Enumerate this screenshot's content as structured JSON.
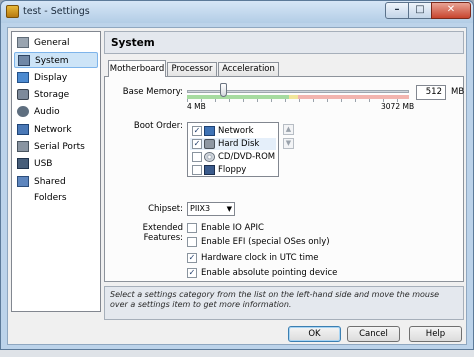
{
  "window": {
    "title": "test - Settings"
  },
  "titlebar": {
    "minimize": "–",
    "maximize": "□",
    "close": "✕"
  },
  "sidebar": {
    "items": [
      {
        "label": "General",
        "icon": "general-icon"
      },
      {
        "label": "System",
        "icon": "system-icon",
        "selected": true
      },
      {
        "label": "Display",
        "icon": "display-icon"
      },
      {
        "label": "Storage",
        "icon": "storage-icon"
      },
      {
        "label": "Audio",
        "icon": "audio-icon"
      },
      {
        "label": "Network",
        "icon": "network-icon"
      },
      {
        "label": "Serial Ports",
        "icon": "serial-ports-icon"
      },
      {
        "label": "USB",
        "icon": "usb-icon"
      },
      {
        "label": "Shared Folders",
        "icon": "shared-folders-icon"
      }
    ]
  },
  "main": {
    "title": "System",
    "tabs": [
      {
        "label": "Motherboard",
        "active": true
      },
      {
        "label": "Processor"
      },
      {
        "label": "Acceleration"
      }
    ],
    "memory": {
      "label": "Base Memory:",
      "value": "512",
      "unit": "MB",
      "min_label": "4 MB",
      "max_label": "3072 MB",
      "fraction": 0.166
    },
    "boot": {
      "label": "Boot Order:",
      "items": [
        {
          "label": "Network",
          "checked": true,
          "icon": "network-icon"
        },
        {
          "label": "Hard Disk",
          "checked": true,
          "icon": "hard-disk-icon"
        },
        {
          "label": "CD/DVD-ROM",
          "checked": false,
          "icon": "cd-dvd-icon"
        },
        {
          "label": "Floppy",
          "checked": false,
          "icon": "floppy-icon"
        }
      ],
      "up": "▲",
      "down": "▼"
    },
    "chipset": {
      "label": "Chipset:",
      "value": "PIIX3",
      "arrow": "▼"
    },
    "features": {
      "label": "Extended Features:",
      "items": [
        {
          "label": "Enable IO APIC",
          "checked": false
        },
        {
          "label": "Enable EFI (special OSes only)",
          "checked": false
        },
        {
          "label": "Hardware clock in UTC time",
          "checked": true
        },
        {
          "label": "Enable absolute pointing device",
          "checked": true
        }
      ]
    }
  },
  "info": {
    "text": "Select a settings category from the list on the left-hand side and move the mouse over a settings item to get more information."
  },
  "buttons": {
    "ok": "OK",
    "cancel": "Cancel",
    "help": "Help"
  },
  "colors": {
    "selection": "#cde4f7",
    "accent": "#3c7fb1",
    "frame": "#bcd3ea"
  }
}
